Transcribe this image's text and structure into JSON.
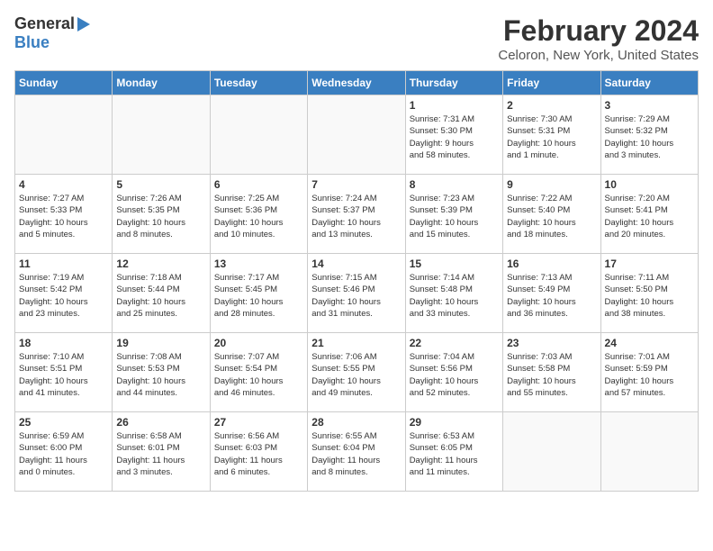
{
  "logo": {
    "general": "General",
    "blue": "Blue"
  },
  "title": "February 2024",
  "subtitle": "Celoron, New York, United States",
  "headers": [
    "Sunday",
    "Monday",
    "Tuesday",
    "Wednesday",
    "Thursday",
    "Friday",
    "Saturday"
  ],
  "weeks": [
    [
      {
        "day": "",
        "info": ""
      },
      {
        "day": "",
        "info": ""
      },
      {
        "day": "",
        "info": ""
      },
      {
        "day": "",
        "info": ""
      },
      {
        "day": "1",
        "info": "Sunrise: 7:31 AM\nSunset: 5:30 PM\nDaylight: 9 hours\nand 58 minutes."
      },
      {
        "day": "2",
        "info": "Sunrise: 7:30 AM\nSunset: 5:31 PM\nDaylight: 10 hours\nand 1 minute."
      },
      {
        "day": "3",
        "info": "Sunrise: 7:29 AM\nSunset: 5:32 PM\nDaylight: 10 hours\nand 3 minutes."
      }
    ],
    [
      {
        "day": "4",
        "info": "Sunrise: 7:27 AM\nSunset: 5:33 PM\nDaylight: 10 hours\nand 5 minutes."
      },
      {
        "day": "5",
        "info": "Sunrise: 7:26 AM\nSunset: 5:35 PM\nDaylight: 10 hours\nand 8 minutes."
      },
      {
        "day": "6",
        "info": "Sunrise: 7:25 AM\nSunset: 5:36 PM\nDaylight: 10 hours\nand 10 minutes."
      },
      {
        "day": "7",
        "info": "Sunrise: 7:24 AM\nSunset: 5:37 PM\nDaylight: 10 hours\nand 13 minutes."
      },
      {
        "day": "8",
        "info": "Sunrise: 7:23 AM\nSunset: 5:39 PM\nDaylight: 10 hours\nand 15 minutes."
      },
      {
        "day": "9",
        "info": "Sunrise: 7:22 AM\nSunset: 5:40 PM\nDaylight: 10 hours\nand 18 minutes."
      },
      {
        "day": "10",
        "info": "Sunrise: 7:20 AM\nSunset: 5:41 PM\nDaylight: 10 hours\nand 20 minutes."
      }
    ],
    [
      {
        "day": "11",
        "info": "Sunrise: 7:19 AM\nSunset: 5:42 PM\nDaylight: 10 hours\nand 23 minutes."
      },
      {
        "day": "12",
        "info": "Sunrise: 7:18 AM\nSunset: 5:44 PM\nDaylight: 10 hours\nand 25 minutes."
      },
      {
        "day": "13",
        "info": "Sunrise: 7:17 AM\nSunset: 5:45 PM\nDaylight: 10 hours\nand 28 minutes."
      },
      {
        "day": "14",
        "info": "Sunrise: 7:15 AM\nSunset: 5:46 PM\nDaylight: 10 hours\nand 31 minutes."
      },
      {
        "day": "15",
        "info": "Sunrise: 7:14 AM\nSunset: 5:48 PM\nDaylight: 10 hours\nand 33 minutes."
      },
      {
        "day": "16",
        "info": "Sunrise: 7:13 AM\nSunset: 5:49 PM\nDaylight: 10 hours\nand 36 minutes."
      },
      {
        "day": "17",
        "info": "Sunrise: 7:11 AM\nSunset: 5:50 PM\nDaylight: 10 hours\nand 38 minutes."
      }
    ],
    [
      {
        "day": "18",
        "info": "Sunrise: 7:10 AM\nSunset: 5:51 PM\nDaylight: 10 hours\nand 41 minutes."
      },
      {
        "day": "19",
        "info": "Sunrise: 7:08 AM\nSunset: 5:53 PM\nDaylight: 10 hours\nand 44 minutes."
      },
      {
        "day": "20",
        "info": "Sunrise: 7:07 AM\nSunset: 5:54 PM\nDaylight: 10 hours\nand 46 minutes."
      },
      {
        "day": "21",
        "info": "Sunrise: 7:06 AM\nSunset: 5:55 PM\nDaylight: 10 hours\nand 49 minutes."
      },
      {
        "day": "22",
        "info": "Sunrise: 7:04 AM\nSunset: 5:56 PM\nDaylight: 10 hours\nand 52 minutes."
      },
      {
        "day": "23",
        "info": "Sunrise: 7:03 AM\nSunset: 5:58 PM\nDaylight: 10 hours\nand 55 minutes."
      },
      {
        "day": "24",
        "info": "Sunrise: 7:01 AM\nSunset: 5:59 PM\nDaylight: 10 hours\nand 57 minutes."
      }
    ],
    [
      {
        "day": "25",
        "info": "Sunrise: 6:59 AM\nSunset: 6:00 PM\nDaylight: 11 hours\nand 0 minutes."
      },
      {
        "day": "26",
        "info": "Sunrise: 6:58 AM\nSunset: 6:01 PM\nDaylight: 11 hours\nand 3 minutes."
      },
      {
        "day": "27",
        "info": "Sunrise: 6:56 AM\nSunset: 6:03 PM\nDaylight: 11 hours\nand 6 minutes."
      },
      {
        "day": "28",
        "info": "Sunrise: 6:55 AM\nSunset: 6:04 PM\nDaylight: 11 hours\nand 8 minutes."
      },
      {
        "day": "29",
        "info": "Sunrise: 6:53 AM\nSunset: 6:05 PM\nDaylight: 11 hours\nand 11 minutes."
      },
      {
        "day": "",
        "info": ""
      },
      {
        "day": "",
        "info": ""
      }
    ]
  ]
}
